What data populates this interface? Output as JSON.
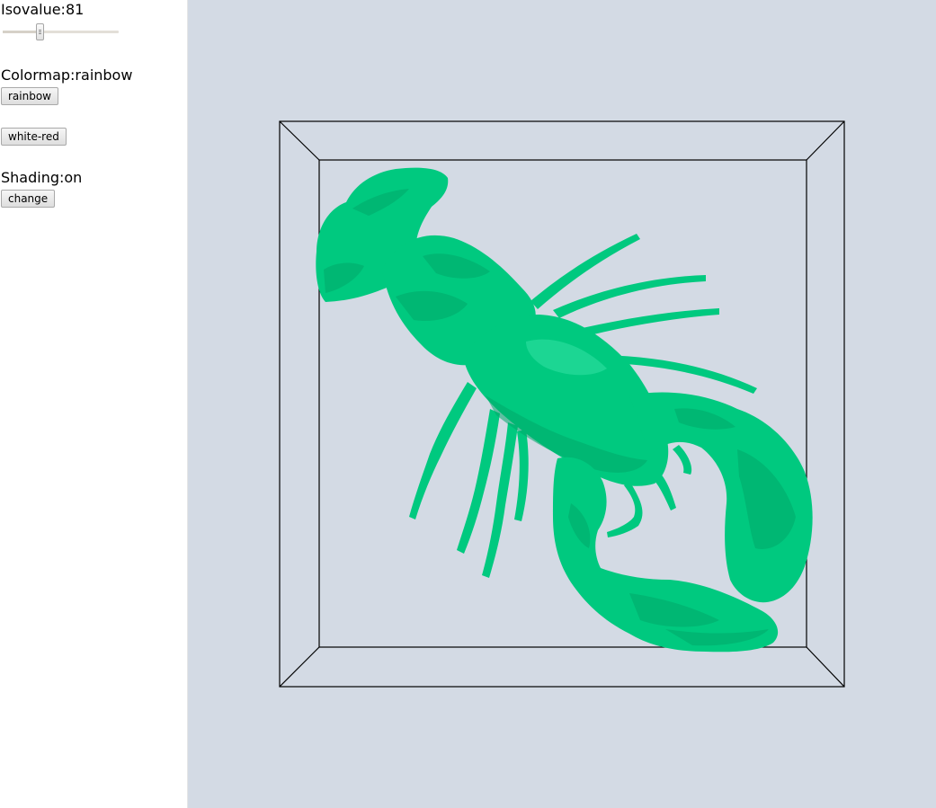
{
  "panel": {
    "isovalue_label": "Isovalue:81",
    "isovalue": 81,
    "isovalue_range": [
      0,
      255
    ],
    "colormap_label": "Colormap:rainbow",
    "colormap_buttons": [
      "rainbow",
      "white-red"
    ],
    "shading_label": "Shading:on",
    "shading_button": "change"
  },
  "viewport": {
    "background": "#d3dae4",
    "surface_color": "#00c97f",
    "surface_shade": "#00a86a",
    "bounding_box_color": "#000000"
  }
}
